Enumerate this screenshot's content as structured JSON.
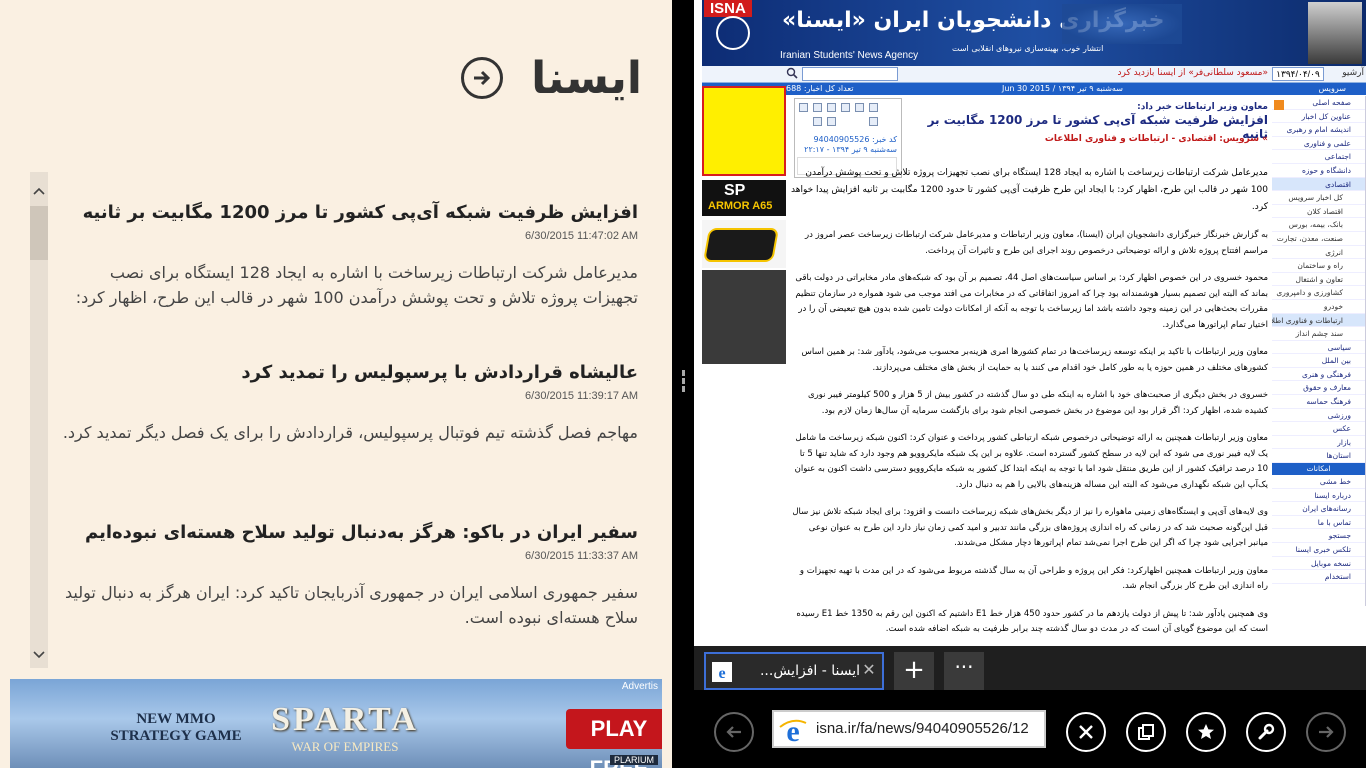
{
  "reader": {
    "app_title": "ایسنا",
    "items": [
      {
        "title": "افزایش ظرفیت شبکه آی‌پی کشور تا مرز 1200 مگابیت بر ثانیه",
        "time": "6/30/2015 11:47:02 AM",
        "body": "مدیرعامل شرکت ارتباطات زیرساخت با اشاره به ایجاد 128 ایستگاه برای نصب تجهیزات پروژه تلاش و تحت پوشش درآمدن 100 شهر در قالب این طرح، اظهار کرد: با"
      },
      {
        "title": "عالیشاه قراردادش با پرسپولیس را تمدید کرد",
        "time": "6/30/2015 11:39:17 AM",
        "body": "مهاجم فصل گذشته تیم فوتبال پرسپولیس، قراردادش را برای یک فصل دیگر تمدید کرد."
      },
      {
        "title": "سفیر ایران در باکو: هرگز به‌دنبال تولید سلاح هسته‌ای نبوده‌ایم",
        "time": "6/30/2015 11:33:37 AM",
        "body": "سفیر جمهوری اسلامی ایران در جمهوری آذربایجان تاکید کرد: ایران هرگز به دنبال تولید سلاح هسته‌ای نبوده است."
      }
    ],
    "ad": {
      "label": "Advertis",
      "game_line1": "NEW MMO",
      "game_line2": "STRATEGY GAME",
      "logo": "SPARTA",
      "logo_sub": "WAR OF EMPIRES",
      "cta": "PLAY FREE",
      "brand": "PLARIUM"
    }
  },
  "site": {
    "isna_logo": "ISNA",
    "name_fa": "خبرگزاری دانشجویان ایران «ایسنا»",
    "name_en": "Iranian Students' News Agency",
    "slogan": "انتشار خوب، بهینه‌سازی نیروهای انقلابی است",
    "headline_link": "«مسعود سلطانی‌فر» از ایسنا بازدید کرد",
    "date_box": "۱۳۹۴/۰۴/۰۹",
    "archive_label": "آرشیو",
    "infobar_count": "تعداد کل اخبار: 688",
    "infobar_date": "سه‌شنبه ۹ تیر ۱۳۹۴ / 2015 Jun 30",
    "infobar_service": "سرویس",
    "ad_sp_logo": "SP",
    "ad_sp_text": "ARMOR A65",
    "share_news_code": "کد خبر: 94040905526",
    "share_news_date": "سه‌شنبه ۹ تیر ۱۳۹۴ - ۲۲:۱۷",
    "article": {
      "kicker": "معاون وزیر ارتباطات خبر داد:",
      "title": "افزایش ظرفیت شبکه آی‌پی کشور تا مرز 1200 مگابیت بر ثانیه",
      "service": "» سرویس: اقتصادی - ارتباطات و فناوری اطلاعات",
      "lead": "مدیرعامل شرکت ارتباطات زیرساخت با اشاره به ایجاد 128 ایستگاه برای نصب تجهیزات پروژه تلاش و تحت پوشش درآمدن 100 شهر در قالب این طرح، اظهار کرد: با ایجاد این طرح ظرفیت آی‌پی کشور تا حدود 1200 مگابیت بر ثانیه افزایش پیدا خواهد کرد.",
      "paragraphs": [
        "به گزارش خبرنگار خبرگزاری دانشجویان ایران (ایسنا)، معاون وزیر ارتباطات و مدیرعامل شرکت ارتباطات زیرساخت عصر امروز در مراسم افتتاح پروژه تلاش و ارائه توضیحاتی درخصوص روند اجرای این طرح و تاثیرات آن پرداخت.",
        "محمود خسروی در این خصوص اظهار کرد: بر اساس سیاست‌های اصل 44، تصمیم بر آن بود که شبکه‌های مادر مخابراتی در دولت باقی بماند که البته این تصمیم بسیار هوشمندانه بود چرا که امروز اتفاقاتی که در مخابرات می افتد موجب می شود همواره در سازمان تنظیم مقررات بحث‌هایی در این زمینه وجود داشته باشد اما زیرساخت با توجه به آنکه از امکانات دولت تامین شده بدون هیچ تبعیضی آن را در اختیار تمام اپراتورها می‌گذارد.",
        "معاون وزیر ارتباطات با تاکید بر اینکه توسعه زیرساخت‌ها در تمام کشورها امری هزینه‌بر محسوب می‌شود، یادآور شد: بر همین اساس کشورهای مختلف در همین حوزه یا به طور کامل خود اقدام می کنند یا به حمایت از بخش های مختلف می‌پردازند.",
        "خسروی در بخش دیگری از صحبت‌های خود با اشاره به اینکه طی دو سال گذشته در کشور بیش از 5 هزار و 500 کیلومتر فیبر نوری کشیده شده، اظهار کرد: اگر قرار بود این موضوع در بخش خصوصی انجام شود برای بازگشت سرمایه آن سال‌ها زمان لازم بود.",
        "معاون وزیر ارتباطات همچنین به ارائه توضیحاتی درخصوص شبکه ارتباطی کشور پرداخت و عنوان کرد: اکنون شبکه زیرساخت ما شامل یک لایه فیبر نوری می شود که این لایه در سطح کشور گسترده است. علاوه بر این یک شبکه مایکروویو هم وجود دارد که شاید تنها 5 تا 10 درصد ترافیک کشور از این طریق منتقل شود اما با توجه به اینکه ابتدا کل کشور به شبکه مایکروویو دسترسی داشت اکنون به عنوان یک‌آپ این شبکه نگهداری می‌شود که البته این مساله هزینه‌های بالایی را هم به دنبال دارد.",
        "وی لایه‌های آی‌پی و ایستگاه‌های زمینی ماهواره را نیز از دیگر بخش‌های شبکه زیرساخت دانست و افزود: برای ایجاد شبکه تلاش نیز سال قبل این‌گونه صحبت شد که در زمانی که راه اندازی پروژه‌های بزرگی مانند تدبیر و امید کمی زمان نیاز دارد این طرح به عنوان نوعی میانبر اجرایی شود چرا که اگر این طرح اجرا نمی‌شد تمام اپراتورها دچار مشکل می‌شدند.",
        "معاون وزیر ارتباطات همچنین اظهارکرد: فکر این پروژه و طراحی آن به سال گذشته مربوط می‌شود که در این مدت با تهیه تجهیزات و راه اندازی این طرح کار بزرگی انجام شد.",
        "وی همچنین یادآور شد: تا پیش از دولت یازدهم ما در کشور حدود 450 هزار خط E1 داشتیم که اکنون این رقم به 1350 خط E1 رسیده است که این موضوع گویای آن است که در مدت دو سال گذشته چند برابر ظرفیت به شبکه اضافه شده است."
      ]
    },
    "sidebar": [
      {
        "label": "صفحه اصلی",
        "kind": "item"
      },
      {
        "label": "عناوین کل اخبار",
        "kind": "item"
      },
      {
        "label": "اندیشه امام و رهبری",
        "kind": "item"
      },
      {
        "label": "علمی و فناوری",
        "kind": "item"
      },
      {
        "label": "اجتماعی",
        "kind": "item"
      },
      {
        "label": "دانشگاه و حوزه",
        "kind": "item"
      },
      {
        "label": "اقتصادی",
        "kind": "item-hl"
      },
      {
        "label": "کل اخبار سرویس",
        "kind": "sub"
      },
      {
        "label": "اقتصاد کلان",
        "kind": "sub"
      },
      {
        "label": "بانک، بیمه، بورس",
        "kind": "sub"
      },
      {
        "label": "صنعت، معدن، تجارت",
        "kind": "sub"
      },
      {
        "label": "انرژی",
        "kind": "sub"
      },
      {
        "label": "راه و ساختمان",
        "kind": "sub"
      },
      {
        "label": "تعاون و اشتغال",
        "kind": "sub"
      },
      {
        "label": "کشاورزی و دامپروری",
        "kind": "sub"
      },
      {
        "label": "خودرو",
        "kind": "sub"
      },
      {
        "label": "ارتباطات و فناوری اطلاعات",
        "kind": "sub-hl"
      },
      {
        "label": "سند چشم انداز",
        "kind": "sub"
      },
      {
        "label": "سیاسی",
        "kind": "item"
      },
      {
        "label": "بین الملل",
        "kind": "item"
      },
      {
        "label": "فرهنگی و هنری",
        "kind": "item"
      },
      {
        "label": "معارف و حقوق",
        "kind": "item"
      },
      {
        "label": "فرهنگ حماسه",
        "kind": "item"
      },
      {
        "label": "ورزشی",
        "kind": "item"
      },
      {
        "label": "عکس",
        "kind": "item"
      },
      {
        "label": "بازار",
        "kind": "item"
      },
      {
        "label": "استان‌ها",
        "kind": "item"
      },
      {
        "label": "امکانات",
        "kind": "head"
      },
      {
        "label": "خط مشی",
        "kind": "item"
      },
      {
        "label": "درباره ایسنا",
        "kind": "item"
      },
      {
        "label": "رسانه‌های ایران",
        "kind": "item"
      },
      {
        "label": "تماس با ما",
        "kind": "item"
      },
      {
        "label": "جستجو",
        "kind": "item"
      },
      {
        "label": "تلکس خبری ایسنا",
        "kind": "item"
      },
      {
        "label": "نسخه موبایل",
        "kind": "item"
      },
      {
        "label": "استخدام",
        "kind": "item"
      }
    ]
  },
  "browser": {
    "tab_title": "ایسنا - افزایش...",
    "new_tab_label": "+",
    "more_label": "···",
    "tab_dots": "• • • • •",
    "address": "isna.ir/fa/news/94040905526/12"
  }
}
